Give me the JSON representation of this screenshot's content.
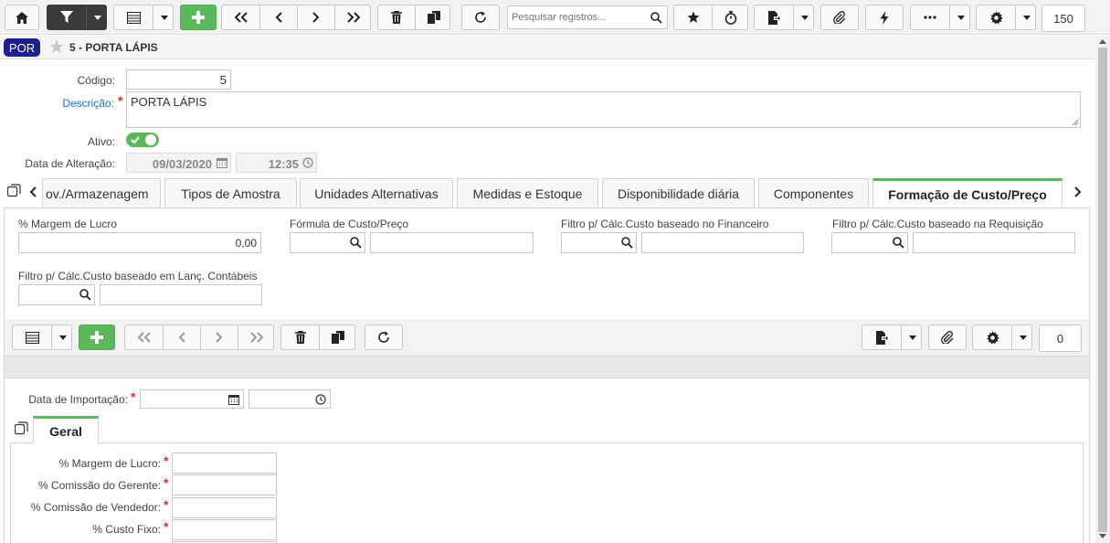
{
  "toolbar": {
    "search_placeholder": "Pesquisar registros...",
    "record_count": "150"
  },
  "header": {
    "badge": "POR",
    "title": "5 - PORTA LÁPIS"
  },
  "form": {
    "codigo_label": "Código:",
    "codigo_value": "5",
    "descricao_label": "Descrição:",
    "descricao_value": "PORTA LÁPIS",
    "ativo_label": "Ativo:",
    "ativo_on": true,
    "data_alteracao_label": "Data de Alteração:",
    "data_alteracao_date": "09/03/2020",
    "data_alteracao_time": "12:35"
  },
  "tabs": [
    {
      "label": "ov./Armazenagem"
    },
    {
      "label": "Tipos de Amostra"
    },
    {
      "label": "Unidades Alternativas"
    },
    {
      "label": "Medidas e Estoque"
    },
    {
      "label": "Disponibilidade diária"
    },
    {
      "label": "Componentes"
    },
    {
      "label": "Formação de Custo/Preço",
      "active": true
    }
  ],
  "custo": {
    "margem_label": "% Margem de Lucro",
    "margem_value": "0,00",
    "formula_label": "Fórmula de Custo/Preço",
    "filtro_fin_label": "Filtro p/ Cálc.Custo baseado no Financeiro",
    "filtro_req_label": "Filtro p/ Cálc.Custo baseado na Requisição",
    "filtro_cont_label": "Filtro p/ Cálc.Custo baseado em Lanç. Contábeis"
  },
  "subgrid": {
    "record_count": "0",
    "data_importacao_label": "Data de Importação:",
    "tab_geral": "Geral",
    "fields": {
      "margem": "% Margem de Lucro:",
      "comissao_gerente": "% Comissão do Gerente:",
      "comissao_vendedor": "% Comissão de Vendedor:",
      "custo_fixo": "% Custo Fixo:"
    }
  },
  "colors": {
    "accent_green": "#5cb85c",
    "badge_bg": "#1f1f8f",
    "link_blue": "#1a6fc9",
    "required_red": "#d9342b"
  }
}
